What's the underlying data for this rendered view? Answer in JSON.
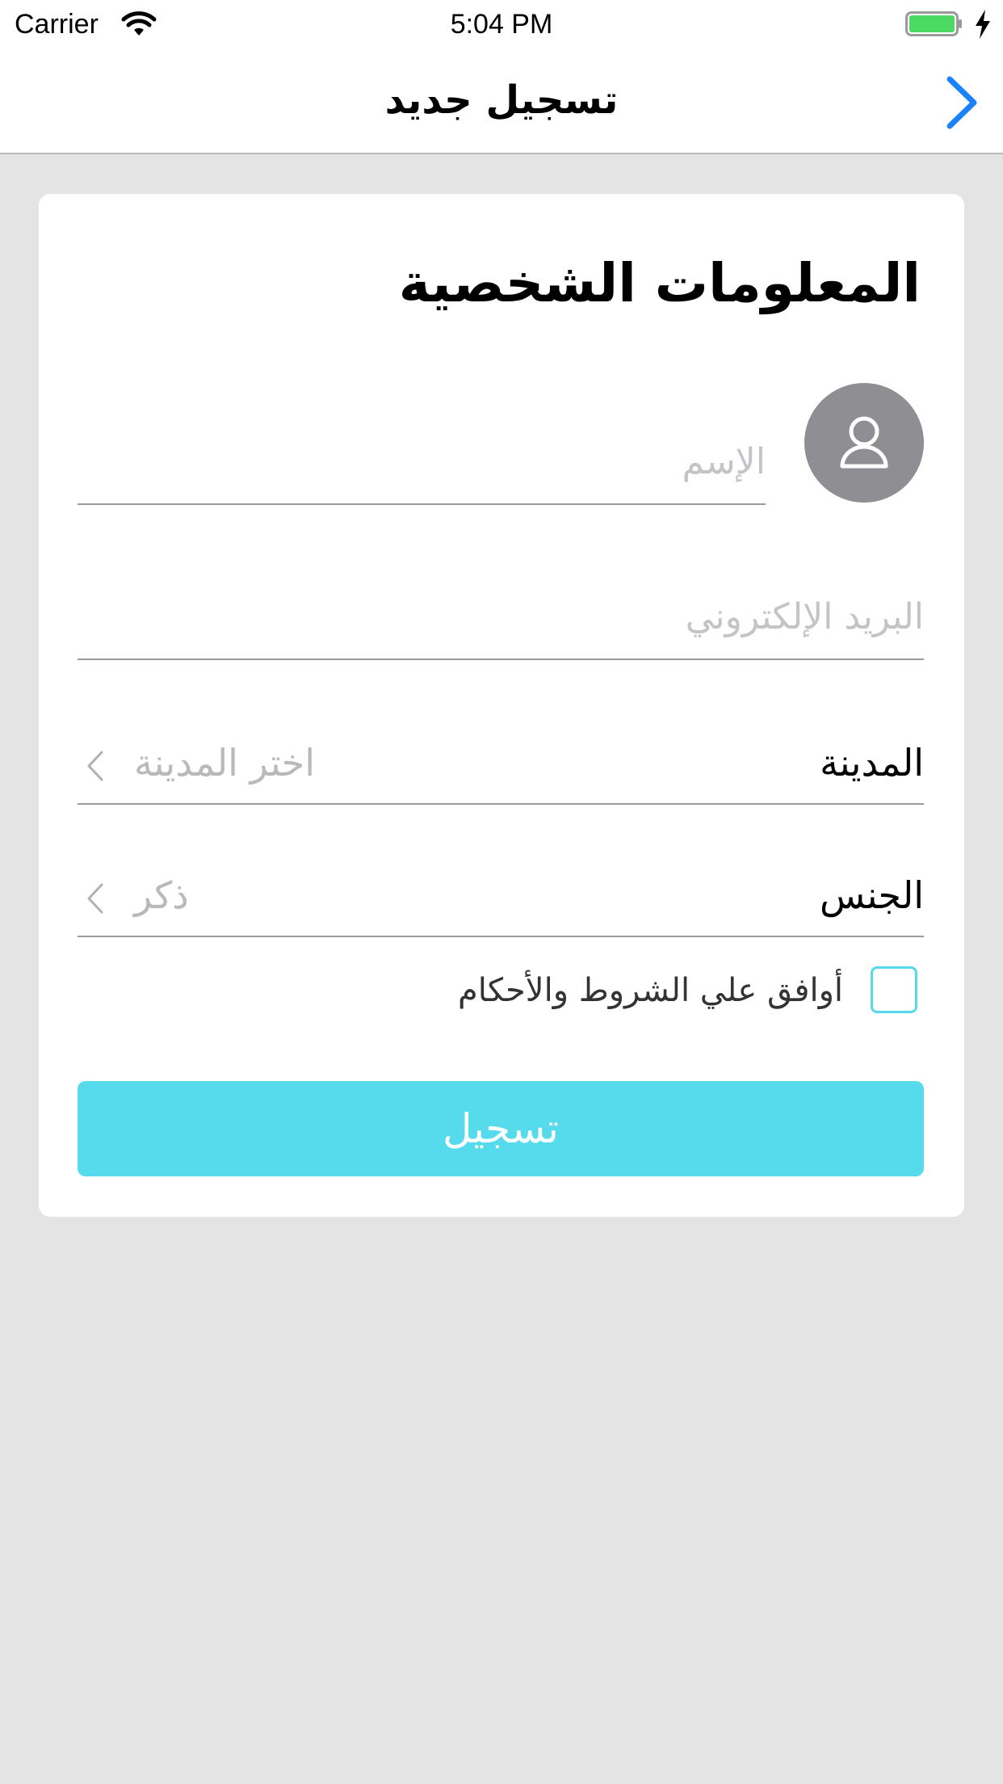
{
  "status_bar": {
    "carrier": "Carrier",
    "time": "5:04 PM",
    "battery_color": "#4cd964"
  },
  "nav": {
    "title": "تسجيل جديد",
    "back_icon": "chevron-right-icon",
    "accent": "#1a82fb"
  },
  "form": {
    "section_title": "المعلومات الشخصية",
    "avatar_icon": "user-icon",
    "name_placeholder": "الإسم",
    "email_placeholder": "البريد الإلكتروني",
    "city": {
      "label": "المدينة",
      "value": "اختر المدينة"
    },
    "gender": {
      "label": "الجنس",
      "value": "ذكر"
    },
    "terms_label": "أوافق علي الشروط والأحكام",
    "terms_checked": false,
    "submit_label": "تسجيل",
    "accent": "#55dbec"
  }
}
